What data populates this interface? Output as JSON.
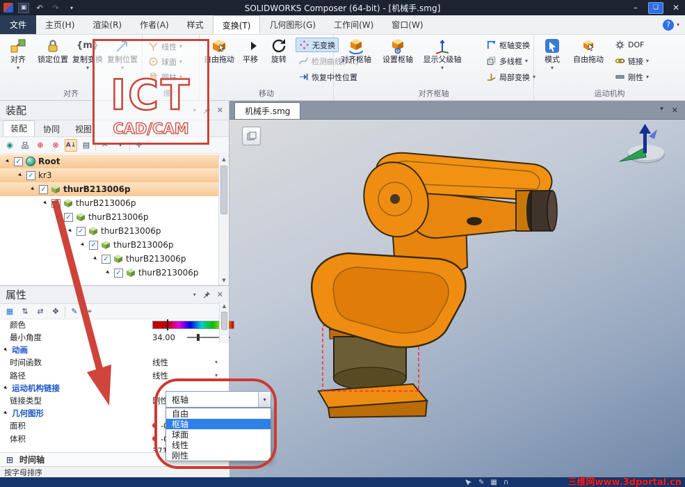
{
  "titlebar": {
    "title": "SOLIDWORKS Composer (64-bit) - [机械手.smg]"
  },
  "menubar": {
    "file": "文件",
    "tabs": [
      "主页(H)",
      "渲染(R)",
      "作者(A)",
      "样式",
      "变换(T)",
      "几何图形(G)",
      "工作间(W)",
      "窗口(W)"
    ],
    "help": "?"
  },
  "ribbon": {
    "align_group": {
      "label": "对齐",
      "align": "对齐",
      "lock": "锁定位置",
      "copy_transform": "复制变换",
      "copy_position": "复制位置"
    },
    "explode_group": {
      "label": "爆炸",
      "linear": "线性",
      "spherical": "球面",
      "cylindrical": "圆柱"
    },
    "move_group": {
      "label": "移动",
      "free_drag": "自由拖动",
      "translate": "平移",
      "rotate": "旋转",
      "no_transform": "无变换",
      "detect_curve": "检测曲线(Alt)",
      "restore_neutral": "恢复中性位置"
    },
    "pivot_group": {
      "label": "对齐枢轴",
      "align_pivot": "对齐枢轴",
      "set_pivot": "设置枢轴",
      "show_parent_axis": "显示父级轴",
      "pivot_transform": "枢轴变换",
      "multi_wireframe": "多线框",
      "local_transform": "局部变换"
    },
    "mechanism_group": {
      "label": "运动机构",
      "mode": "模式",
      "free_drag": "自由拖动",
      "dof": "DOF",
      "link": "链接",
      "rigid": "刚性"
    }
  },
  "assembly": {
    "title": "装配",
    "tabs": [
      "装配",
      "协同",
      "视图"
    ],
    "tree": [
      {
        "label": "Root"
      },
      {
        "label": "kr3"
      },
      {
        "label": "thurB213006p"
      },
      {
        "label": "thurB213006p"
      },
      {
        "label": "thurB213006p"
      },
      {
        "label": "thurB213006p"
      },
      {
        "label": "thurB213006p"
      },
      {
        "label": "thurB213006p"
      },
      {
        "label": "thurB213006p"
      }
    ]
  },
  "properties": {
    "title": "属性",
    "color": {
      "label": "颜色"
    },
    "min_angle": {
      "label": "最小角度",
      "value": "34.00"
    },
    "animation_section": "动画",
    "time_function": {
      "label": "时间函数",
      "value": "线性"
    },
    "path": {
      "label": "路径",
      "value": "线性"
    },
    "mechanism_section": "运动机构链接",
    "link_type": {
      "label": "链接类型",
      "value": "刚性"
    },
    "geometry_section": "几何图形",
    "area": {
      "label": "面积",
      "value": "-0.010"
    },
    "volume": {
      "label": "体积",
      "value": "-0.001"
    },
    "extra_value": "37110.05",
    "timeline_section": "时间轴"
  },
  "link_type_dropdown": {
    "display": "枢轴",
    "options": [
      "自由",
      "枢轴",
      "球面",
      "线性",
      "刚性"
    ]
  },
  "viewport": {
    "doc_tab": "机械手.smg"
  },
  "statusbar": {
    "sort_label": "按字母排序",
    "site_text": "三维网www.3dportal.cn"
  },
  "watermark": {
    "line1": "ICT",
    "line2": "CAD/CAM"
  },
  "colors": {
    "robot_orange": "#ef8d12",
    "selection_peach": "#f8c793",
    "dropdown_selection": "#2f7fe8",
    "annotation_red": "#cb3a31",
    "site_text_red": "#ff1c1c"
  }
}
